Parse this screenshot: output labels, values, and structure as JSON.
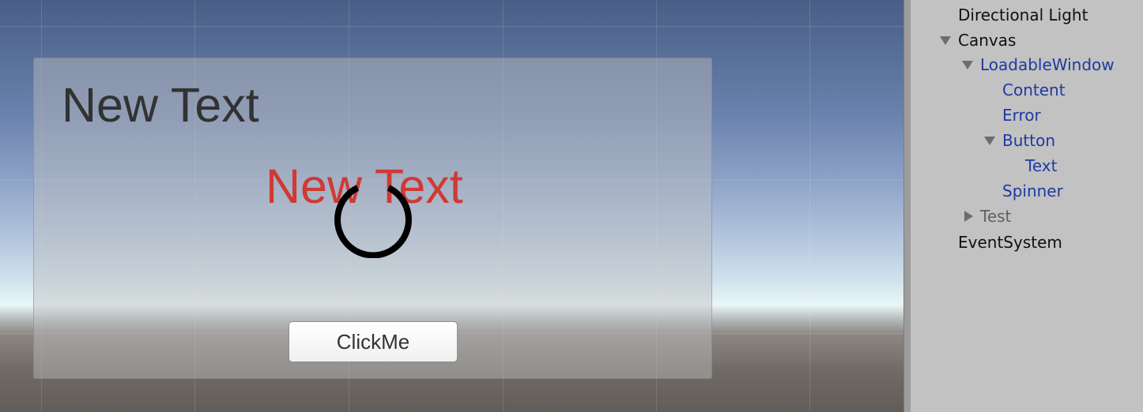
{
  "scene": {
    "heading_text": "New Text",
    "error_text": "New Text",
    "button_label": "ClickMe",
    "colors": {
      "heading_text": "#323232",
      "error_text": "#cf3a34",
      "spinner": "#000000"
    }
  },
  "hierarchy": {
    "items": [
      {
        "label": "Directional Light",
        "expander": "none"
      },
      {
        "label": "Canvas",
        "expander": "expanded"
      },
      {
        "label": "LoadableWindow",
        "expander": "expanded"
      },
      {
        "label": "Content",
        "expander": "none"
      },
      {
        "label": "Error",
        "expander": "none"
      },
      {
        "label": "Button",
        "expander": "expanded"
      },
      {
        "label": "Text",
        "expander": "none"
      },
      {
        "label": "Spinner",
        "expander": "none"
      },
      {
        "label": "Test",
        "expander": "collapsed"
      },
      {
        "label": "EventSystem",
        "expander": "none"
      }
    ],
    "colors": {
      "default": "#111111",
      "selected": "#1f3aa0",
      "inactive": "#606060"
    }
  }
}
